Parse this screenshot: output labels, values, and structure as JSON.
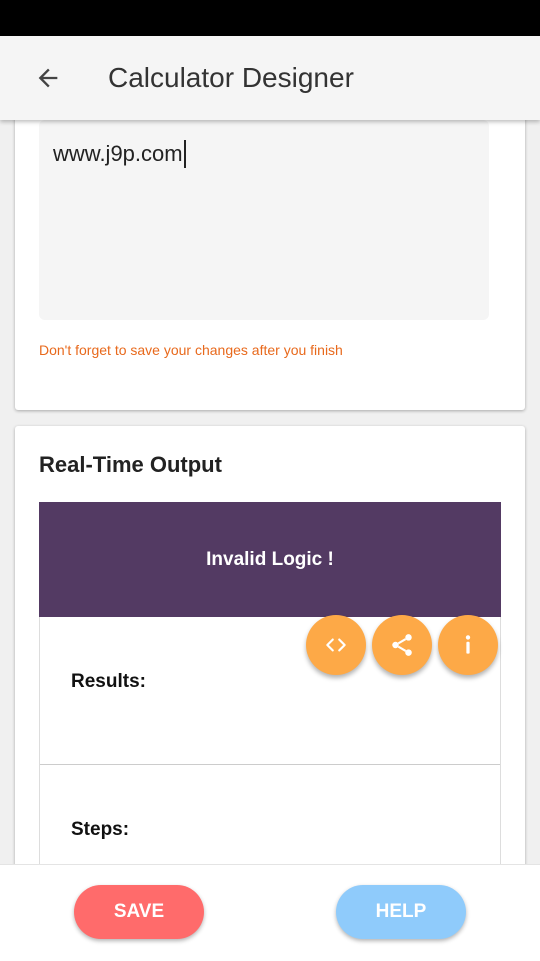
{
  "app_bar": {
    "title": "Calculator Designer",
    "back_icon": "arrow-back-icon"
  },
  "editor": {
    "value": "www.j9p.com",
    "hint": "Don't forget to save your changes after you finish"
  },
  "output": {
    "title": "Real-Time Output",
    "header_text": "Invalid Logic !",
    "header_color": "#533a63",
    "results_label": "Results:",
    "steps_label": "Steps:"
  },
  "fabs": [
    {
      "icon": "code-icon"
    },
    {
      "icon": "share-icon"
    },
    {
      "icon": "info-icon"
    }
  ],
  "fab_color": "#fda947",
  "bottom": {
    "save_label": "SAVE",
    "save_color": "#ff6b6b",
    "help_label": "HELP",
    "help_color": "#8fcbfb"
  }
}
